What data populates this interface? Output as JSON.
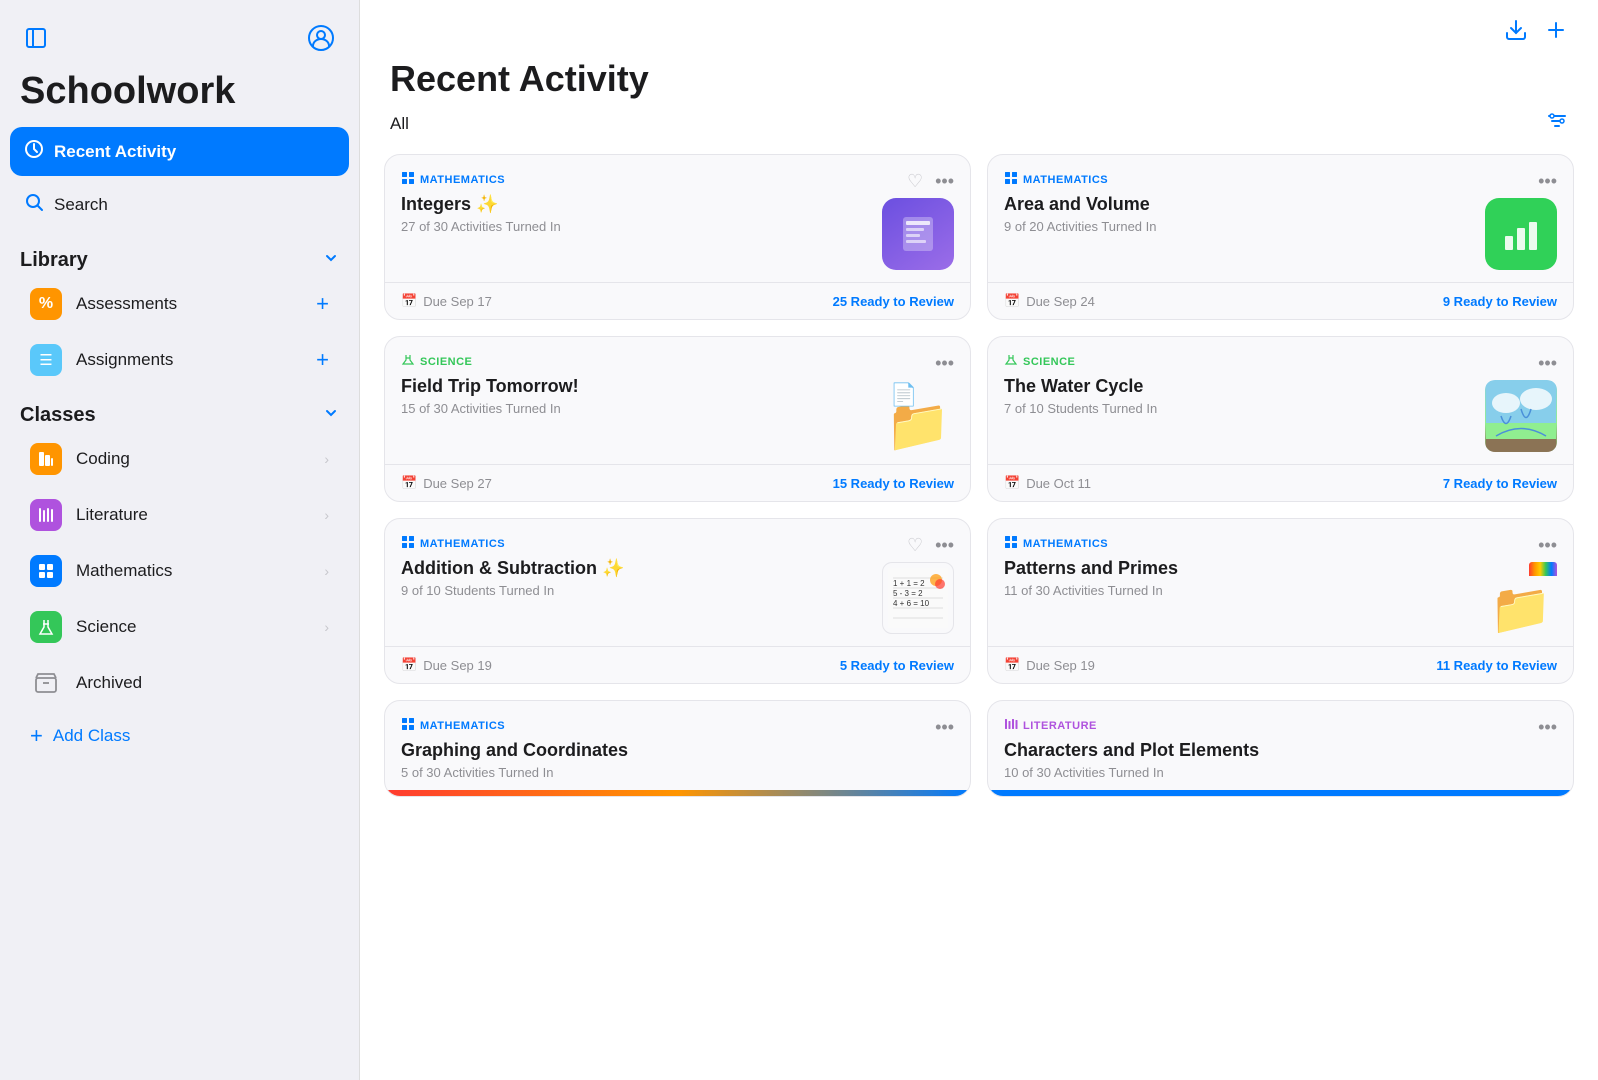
{
  "app": {
    "title": "Schoolwork"
  },
  "sidebar": {
    "toggle_icon": "⊞",
    "profile_icon": "👤",
    "nav": {
      "recent_activity": "Recent Activity",
      "search": "Search"
    },
    "library": {
      "title": "Library",
      "items": [
        {
          "id": "assessments",
          "label": "Assessments",
          "icon": "%"
        },
        {
          "id": "assignments",
          "label": "Assignments",
          "icon": "☰"
        }
      ]
    },
    "classes": {
      "title": "Classes",
      "items": [
        {
          "id": "coding",
          "label": "Coding",
          "color": "orange"
        },
        {
          "id": "literature",
          "label": "Literature",
          "color": "purple"
        },
        {
          "id": "mathematics",
          "label": "Mathematics",
          "color": "blue"
        },
        {
          "id": "science",
          "label": "Science",
          "color": "green"
        }
      ]
    },
    "archived": "Archived",
    "add_class": "Add Class"
  },
  "main": {
    "page_title": "Recent Activity",
    "filter_label": "All",
    "cards": [
      {
        "id": "integers",
        "class_label": "MATHEMATICS",
        "class_type": "math",
        "title": "Integers ✨",
        "subtitle": "27 of 30 Activities Turned In",
        "thumb_type": "keynote",
        "due": "Due Sep 17",
        "review": "25 Ready to Review",
        "has_heart": true
      },
      {
        "id": "area-volume",
        "class_label": "MATHEMATICS",
        "class_type": "math",
        "title": "Area and Volume",
        "subtitle": "9 of 20 Activities Turned In",
        "thumb_type": "numbers",
        "due": "Due Sep 24",
        "review": "9 Ready to Review",
        "has_heart": false
      },
      {
        "id": "field-trip",
        "class_label": "SCIENCE",
        "class_type": "science",
        "title": "Field Trip Tomorrow!",
        "subtitle": "15 of 30 Activities Turned In",
        "thumb_type": "folder-blue",
        "due": "Due Sep 27",
        "review": "15 Ready to Review",
        "has_heart": false
      },
      {
        "id": "water-cycle",
        "class_label": "SCIENCE",
        "class_type": "science",
        "title": "The Water Cycle",
        "subtitle": "7 of 10 Students Turned In",
        "thumb_type": "water-cycle",
        "due": "Due Oct 11",
        "review": "7 Ready to Review",
        "has_heart": false
      },
      {
        "id": "addition-subtraction",
        "class_label": "MATHEMATICS",
        "class_type": "math",
        "title": "Addition & Subtraction ✨",
        "subtitle": "9 of 10 Students Turned In",
        "thumb_type": "addition",
        "due": "Due Sep 19",
        "review": "5 Ready to Review",
        "has_heart": true
      },
      {
        "id": "patterns-primes",
        "class_label": "MATHEMATICS",
        "class_type": "math",
        "title": "Patterns and Primes",
        "subtitle": "11 of 30 Activities Turned In",
        "thumb_type": "patterns",
        "due": "Due Sep 19",
        "review": "11 Ready to Review",
        "has_heart": false
      }
    ],
    "partial_cards": [
      {
        "id": "graphing-coordinates",
        "class_label": "MATHEMATICS",
        "class_type": "math",
        "title": "Graphing and Coordinates",
        "subtitle": "5 of 30 Activities Turned In"
      },
      {
        "id": "characters-plot",
        "class_label": "LITERATURE",
        "class_type": "literature",
        "title": "Characters and Plot Elements",
        "subtitle": "10 of 30 Activities Turned In"
      }
    ]
  }
}
